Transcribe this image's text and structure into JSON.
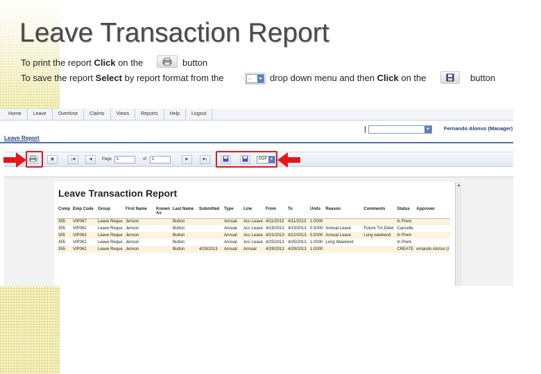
{
  "slide": {
    "title": "Leave Transaction Report",
    "line1": {
      "before": "To print the report ",
      "bold": "Click",
      "middle": " on the",
      "after": "button"
    },
    "line2": {
      "before": "To save the report ",
      "bold1": "Select",
      "middle1": " by report format from the",
      "middle2": "drop down menu and then ",
      "bold2": "Click",
      "middle3": " on the",
      "after": "button"
    }
  },
  "app": {
    "nav_tabs": [
      "Home",
      "Leave",
      "Overtime",
      "Claims",
      "Views",
      "Reports",
      "Help",
      "Logout"
    ],
    "user_name": "Fernando Alonso (Manager)",
    "section_title": "Leave Report",
    "toolbar": {
      "page_label": "Page",
      "page_value": "1",
      "of_label": "of",
      "of_value": "1",
      "format_value": "PDF"
    }
  },
  "report": {
    "title": "Leave Transaction Report",
    "columns": [
      "Comp",
      "Emp Code",
      "Group",
      "First Name",
      "Known As",
      "Last Name",
      "Submitted",
      "Type",
      "Line",
      "From",
      "To",
      "Units",
      "Reason",
      "Comments",
      "Status",
      "Approver"
    ],
    "rows": [
      [
        "355",
        "VIP067",
        "Leave Reque",
        "Jenson",
        "",
        "Button",
        "",
        "Annual",
        "Acc Leave",
        "4/11/2013",
        "4/11/2013",
        "1.0000",
        "",
        "",
        "In Prem",
        ""
      ],
      [
        "355",
        "VIP062",
        "Leave Reque",
        "Jenson",
        "",
        "Button",
        "",
        "Annual",
        "Acc Leave",
        "4/19/2013",
        "4/19/2013",
        "0.5000",
        "Annual Leave",
        "Future Tm Delet",
        "Cancelle",
        ""
      ],
      [
        "355",
        "VIP062",
        "Leave Reque",
        "Jenson",
        "",
        "Button",
        "",
        "Annual",
        "Acc Leave",
        "4/22/2013",
        "4/22/2013",
        "0.5000",
        "Annual Leave",
        "Long weekend",
        "In Prem",
        ""
      ],
      [
        "355",
        "VIP062",
        "Leave Reque",
        "Jenson",
        "",
        "Button",
        "",
        "Annual",
        "Acc Leave",
        "4/25/2013",
        "4/25/2013",
        "1.0000",
        "Long Weekend",
        "",
        "In Prem",
        ""
      ],
      [
        "355",
        "VIP062",
        "Leave Reque",
        "Jenson",
        "",
        "Button",
        "4/29/2013",
        "Annual",
        "Annual",
        "4/29/2013",
        "4/29/2013",
        "1.0000",
        "",
        "",
        "CREATE",
        "ernando Alonso (I"
      ]
    ]
  }
}
